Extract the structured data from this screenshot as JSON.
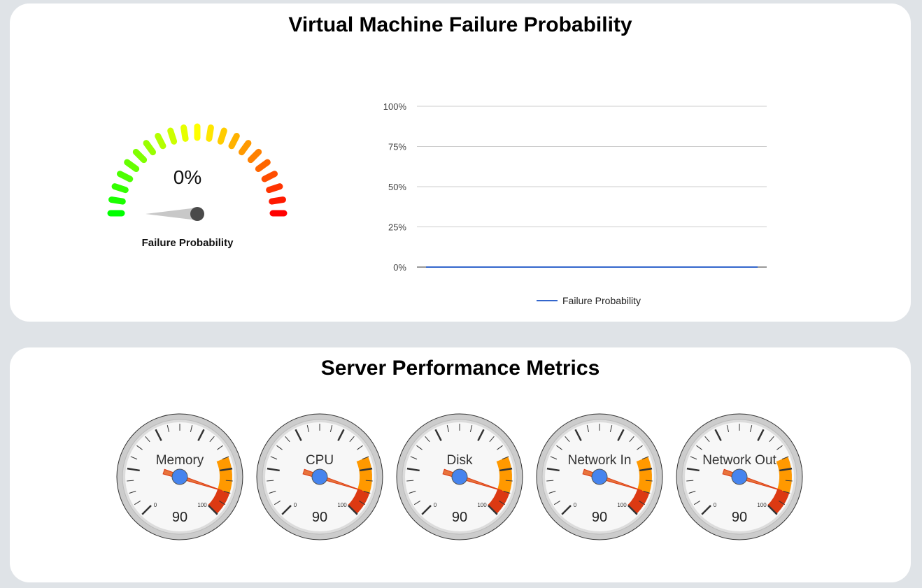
{
  "failure_section": {
    "title": "Virtual Machine Failure Probability",
    "gauge": {
      "value": 0,
      "value_text": "0%",
      "label": "Failure Probability"
    }
  },
  "chart_data": {
    "type": "line",
    "title": "",
    "xlabel": "",
    "ylabel": "",
    "y_ticks": [
      "0%",
      "25%",
      "50%",
      "75%",
      "100%"
    ],
    "ylim": [
      0,
      100
    ],
    "grid": true,
    "legend_position": "bottom",
    "series": [
      {
        "name": "Failure Probability",
        "color": "#3366cc",
        "values": [
          0,
          0
        ]
      }
    ]
  },
  "metrics_section": {
    "title": "Server Performance Metrics",
    "gauges": [
      {
        "label": "Memory",
        "value": 90,
        "value_text": "90",
        "min_label": "0",
        "max_label": "100"
      },
      {
        "label": "CPU",
        "value": 90,
        "value_text": "90",
        "min_label": "0",
        "max_label": "100"
      },
      {
        "label": "Disk",
        "value": 90,
        "value_text": "90",
        "min_label": "0",
        "max_label": "100"
      },
      {
        "label": "Network In",
        "value": 90,
        "value_text": "90",
        "min_label": "0",
        "max_label": "100"
      },
      {
        "label": "Network Out",
        "value": 90,
        "value_text": "90",
        "min_label": "0",
        "max_label": "100"
      }
    ],
    "colors": {
      "yellow_band": "#ff9900",
      "red_band": "#dc3912",
      "needle": "#dc3912",
      "hub": "#4684ee"
    }
  }
}
